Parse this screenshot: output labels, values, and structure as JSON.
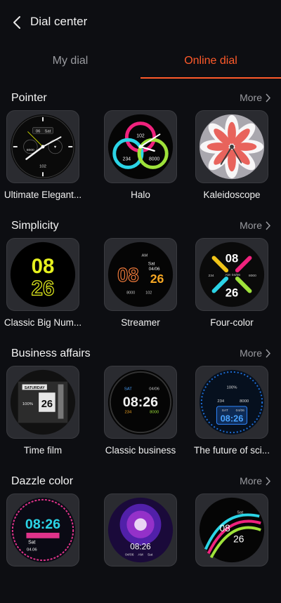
{
  "header": {
    "title": "Dial center",
    "back_icon": "chevron-left-icon"
  },
  "tabs": [
    {
      "label": "My dial",
      "active": false
    },
    {
      "label": "Online dial",
      "active": true
    }
  ],
  "colors": {
    "accent": "#ff5a2a",
    "background": "#0d0e12",
    "muted_text": "#9a9ba0"
  },
  "sections": [
    {
      "title": "Pointer",
      "more": "More",
      "dials": [
        {
          "name": "Ultimate Elegant...",
          "face": {
            "date_day": "06",
            "date_weekday": "Sat",
            "left_value": "8000",
            "bottom_value": "102"
          }
        },
        {
          "name": "Halo",
          "face": {
            "top_value": "102",
            "left_value": "234",
            "right_value": "8000"
          }
        },
        {
          "name": "Kaleidoscope",
          "face": {}
        }
      ]
    },
    {
      "title": "Simplicity",
      "more": "More",
      "dials": [
        {
          "name": "Classic Big Num...",
          "face": {
            "hours": "08",
            "minutes": "26"
          }
        },
        {
          "name": "Streamer",
          "face": {
            "hours": "08",
            "minutes": "26",
            "ampm": "AM",
            "weekday": "Sat",
            "date": "04/06",
            "steps": "8000",
            "hr": "102"
          }
        },
        {
          "name": "Four-color",
          "face": {
            "hours": "08",
            "minutes": "26",
            "ampm": "AM",
            "date": "04/06",
            "left_value": "234",
            "right_value": "8000"
          }
        }
      ]
    },
    {
      "title": "Business affairs",
      "more": "More",
      "dials": [
        {
          "name": "Time film",
          "face": {
            "weekday": "SATURDAY",
            "battery": "100%",
            "minutes": "26"
          }
        },
        {
          "name": "Classic business",
          "face": {
            "weekday": "SAT",
            "date": "04/06",
            "time": "08:26",
            "left_value": "234",
            "right_value": "8000"
          }
        },
        {
          "name": "The future of sci...",
          "face": {
            "top_value": "100%",
            "left_value": "234",
            "right_value": "8000",
            "weekday": "SAT",
            "date": "04/06",
            "time": "08:26"
          }
        }
      ]
    },
    {
      "title": "Dazzle color",
      "more": "More",
      "dials": [
        {
          "name": "",
          "face": {
            "time": "08:26",
            "weekday": "Sat",
            "date": "04.06"
          }
        },
        {
          "name": "",
          "face": {
            "time": "08:26",
            "date": "04/06",
            "ampm": "AM",
            "weekday": "Sat"
          }
        },
        {
          "name": "",
          "face": {
            "hours": "08",
            "minutes": "26",
            "weekday": "Sat"
          }
        }
      ]
    }
  ]
}
